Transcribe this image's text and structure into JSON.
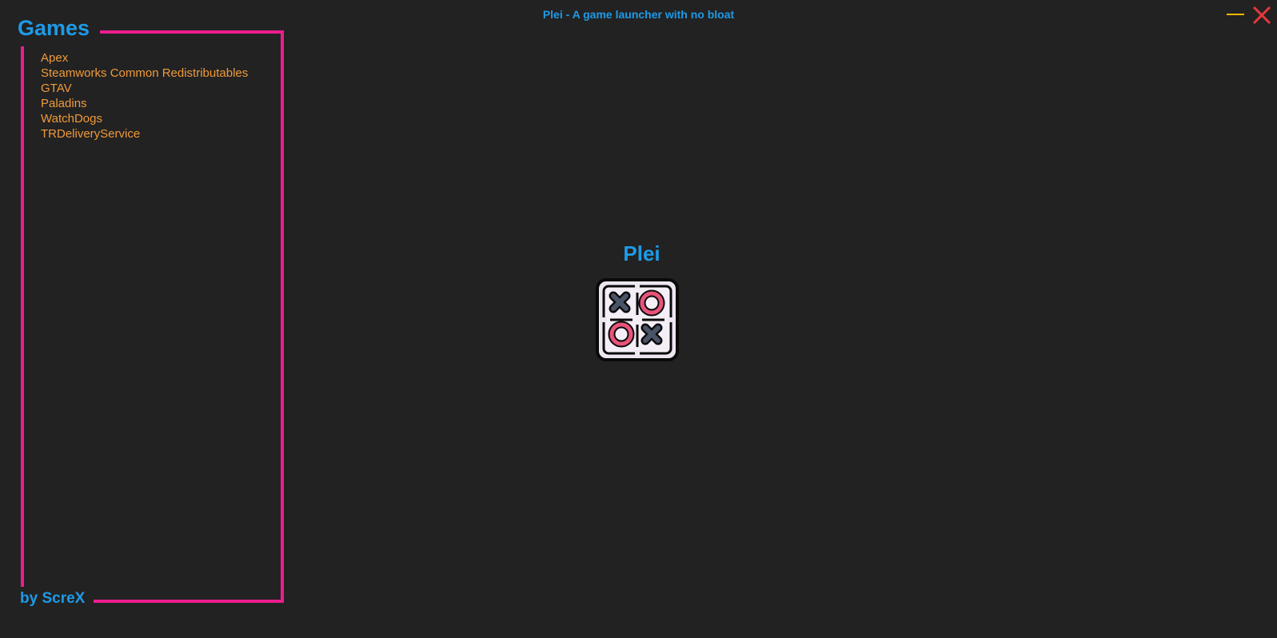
{
  "window": {
    "title": "Plei - A game launcher with no bloat",
    "minimize_icon": "minimize-icon",
    "close_icon": "close-icon"
  },
  "sidebar": {
    "heading": "Games",
    "footer": "by ScreX",
    "games": [
      "Apex",
      "Steamworks Common Redistributables",
      "GTAV",
      "Paladins",
      "WatchDogs",
      "TRDeliveryService"
    ]
  },
  "main": {
    "title": "Plei",
    "logo_icon": "tic-tac-toe-icon"
  },
  "colors": {
    "background": "#222222",
    "accent_blue": "#1e9ae6",
    "frame_pink": "#ec1d8e",
    "game_orange": "#f09a3a",
    "close_red": "#e8383d",
    "minimize_yellow": "#f5b800"
  }
}
